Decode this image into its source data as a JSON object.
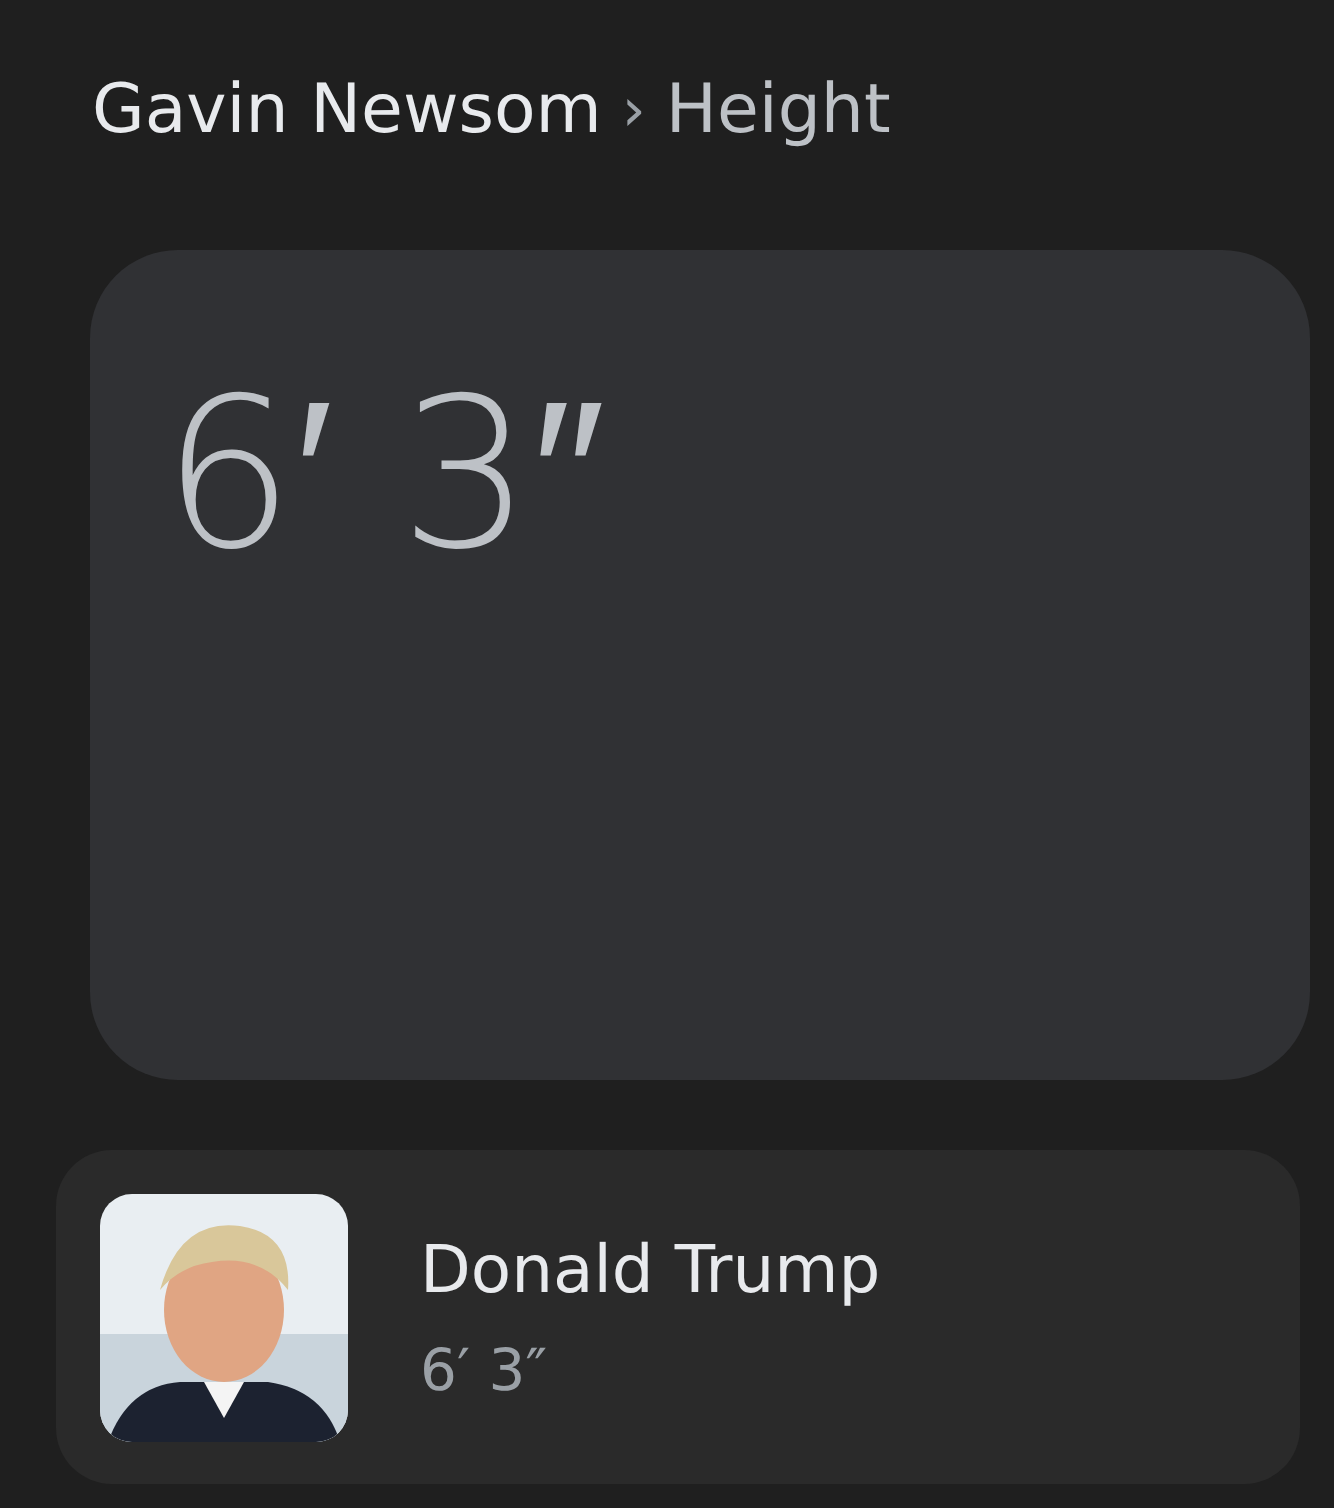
{
  "breadcrumb": {
    "entity": "Gavin Newsom",
    "separator": "›",
    "attribute": "Height"
  },
  "answer": "6′ 3″",
  "related": [
    {
      "name": "Donald Trump",
      "value": "6′ 3″"
    }
  ]
}
